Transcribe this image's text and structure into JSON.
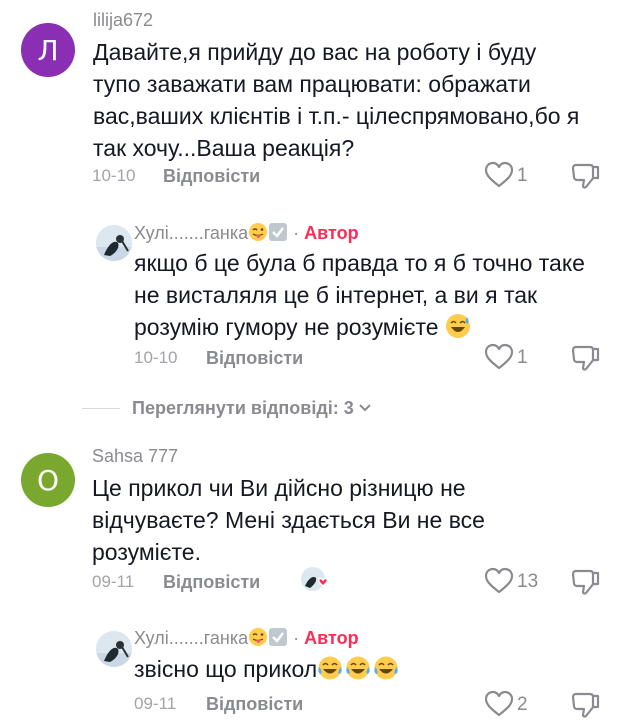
{
  "comments": [
    {
      "avatar_letter": "Л",
      "avatar_color": "#8a2fb3",
      "username": "lilija672",
      "lines": [
        "Давайте,я прийду до вас на роботу і буду",
        "тупо заважати вам працювати: ображати",
        "вас,ваших клієнтів і т.п.- цілеспрямовано,бо я",
        "так хочу...Ваша реакція?"
      ],
      "date": "10-10",
      "reply_label": "Відповісти",
      "likes": "1"
    },
    {
      "username": "Хулі.......ганка",
      "author_label": "Автор",
      "separator": "·",
      "lines": [
        "якщо б це була б правда то я б точно таке",
        "не висталяля це б інтернет, а ви я так",
        "розумію гумору не розумієте"
      ],
      "date": "10-10",
      "reply_label": "Відповісти",
      "likes": "1"
    },
    {
      "avatar_letter": "О",
      "avatar_color": "#7aa82e",
      "username": "Sahsa 777",
      "lines": [
        "Це прикол чи Ви дійсно різницю не",
        "відчуваєте? Мені здається Ви не все",
        "розумієте."
      ],
      "date": "09-11",
      "reply_label": "Відповісти",
      "likes": "13"
    },
    {
      "username": "Хулі.......ганка",
      "author_label": "Автор",
      "separator": "·",
      "lines": [
        "звісно що прикол"
      ],
      "date": "09-11",
      "reply_label": "Відповісти",
      "likes": "2"
    }
  ],
  "view_replies": "Переглянути відповіді: 3",
  "icons": {
    "like": "heart-outline-icon",
    "dislike": "thumbs-down-icon",
    "chevron": "chevron-down-icon",
    "check": "check-box-icon",
    "tongue": "tongue-emoji-icon",
    "sweat": "sweat-smile-emoji-icon",
    "laugh": "tears-of-joy-emoji-icon",
    "liked_by_creator": "creator-liked-icon"
  },
  "colors": {
    "author": "#fe2c55",
    "muted": "#8a8b91",
    "text": "#161823"
  }
}
